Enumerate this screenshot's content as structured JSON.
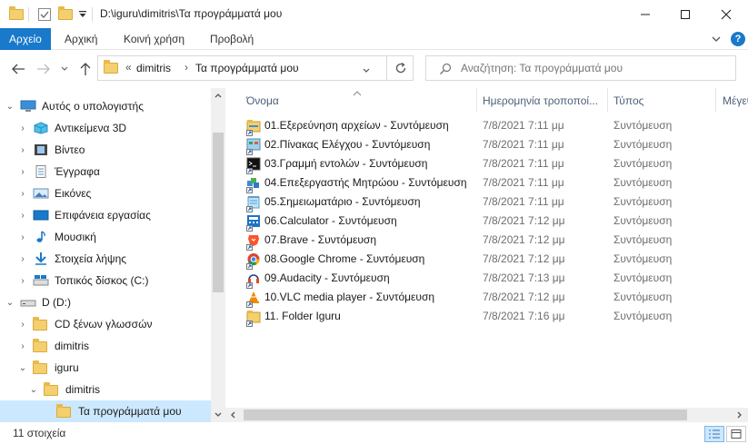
{
  "window": {
    "title": "D:\\iguru\\dimitris\\Τα προγράμματά μου",
    "minimize_glyph": "—",
    "maximize_glyph": "☐",
    "close_glyph": "✕"
  },
  "ribbon": {
    "tabs": [
      "Αρχείο",
      "Αρχική",
      "Κοινή χρήση",
      "Προβολή"
    ],
    "help_glyph": "?",
    "expand_glyph": "⌄"
  },
  "address": {
    "overflow": "«",
    "crumbs": [
      "dimitris",
      "Τα προγράμματά μου"
    ],
    "separator": "›",
    "refresh_glyph": "↻"
  },
  "search": {
    "placeholder": "Αναζήτηση: Τα προγράμματά μου"
  },
  "nav": {
    "items": [
      {
        "label": "Αυτός ο υπολογιστής",
        "icon": "computer-icon",
        "chev": "⌄"
      },
      {
        "label": "Αντικείμενα 3D",
        "icon": "3d-objects-icon",
        "chev": "›"
      },
      {
        "label": "Βίντεο",
        "icon": "video-icon",
        "chev": "›"
      },
      {
        "label": "Έγγραφα",
        "icon": "documents-icon",
        "chev": "›"
      },
      {
        "label": "Εικόνες",
        "icon": "pictures-icon",
        "chev": "›"
      },
      {
        "label": "Επιφάνεια εργασίας",
        "icon": "desktop-icon",
        "chev": "›"
      },
      {
        "label": "Μουσική",
        "icon": "music-icon",
        "chev": "›"
      },
      {
        "label": "Στοιχεία λήψης",
        "icon": "downloads-icon",
        "chev": "›"
      },
      {
        "label": "Τοπικός δίσκος (C:)",
        "icon": "drive-c-icon",
        "chev": "›"
      },
      {
        "label": "D (D:)",
        "icon": "drive-d-icon",
        "chev": "⌄"
      },
      {
        "label": "CD ξένων γλωσσών",
        "icon": "folder-icon",
        "chev": "›"
      },
      {
        "label": "dimitris",
        "icon": "folder-icon",
        "chev": "›"
      },
      {
        "label": "iguru",
        "icon": "folder-icon",
        "chev": "⌄"
      },
      {
        "label": "dimitris",
        "icon": "folder-icon",
        "chev": "⌄"
      },
      {
        "label": "Τα προγράμματά μου",
        "icon": "folder-icon",
        "chev": ""
      }
    ]
  },
  "columns": {
    "name": "Όνομα",
    "date": "Ημερομηνία τροποποί...",
    "type": "Τύπος",
    "size": "Μέγεθ"
  },
  "files": [
    {
      "name": "01.Εξερεύνηση αρχείων - Συντόμευση",
      "date": "7/8/2021 7:11 μμ",
      "type": "Συντόμευση",
      "icon": "file-explorer-icon"
    },
    {
      "name": "02.Πίνακας Ελέγχου - Συντόμευση",
      "date": "7/8/2021 7:11 μμ",
      "type": "Συντόμευση",
      "icon": "control-panel-icon"
    },
    {
      "name": "03.Γραμμή εντολών - Συντόμευση",
      "date": "7/8/2021 7:11 μμ",
      "type": "Συντόμευση",
      "icon": "command-prompt-icon"
    },
    {
      "name": "04.Επεξεργαστής Μητρώου - Συντόμευση",
      "date": "7/8/2021 7:11 μμ",
      "type": "Συντόμευση",
      "icon": "registry-editor-icon"
    },
    {
      "name": "05.Σημειωματάριο - Συντόμευση",
      "date": "7/8/2021 7:11 μμ",
      "type": "Συντόμευση",
      "icon": "notepad-icon"
    },
    {
      "name": "06.Calculator - Συντόμευση",
      "date": "7/8/2021 7:12 μμ",
      "type": "Συντόμευση",
      "icon": "calculator-icon"
    },
    {
      "name": "07.Brave - Συντόμευση",
      "date": "7/8/2021 7:12 μμ",
      "type": "Συντόμευση",
      "icon": "brave-icon"
    },
    {
      "name": "08.Google Chrome - Συντόμευση",
      "date": "7/8/2021 7:12 μμ",
      "type": "Συντόμευση",
      "icon": "chrome-icon"
    },
    {
      "name": "09.Audacity - Συντόμευση",
      "date": "7/8/2021 7:13 μμ",
      "type": "Συντόμευση",
      "icon": "audacity-icon"
    },
    {
      "name": "10.VLC media player - Συντόμευση",
      "date": "7/8/2021 7:12 μμ",
      "type": "Συντόμευση",
      "icon": "vlc-icon"
    },
    {
      "name": "11. Folder Iguru",
      "date": "7/8/2021 7:16 μμ",
      "type": "Συντόμευση",
      "icon": "folder-shortcut-icon"
    }
  ],
  "status": {
    "count": "11 στοιχεία"
  },
  "colors": {
    "accent": "#1979ca",
    "selection": "#cce8ff",
    "folder": "#f4cf6e"
  }
}
